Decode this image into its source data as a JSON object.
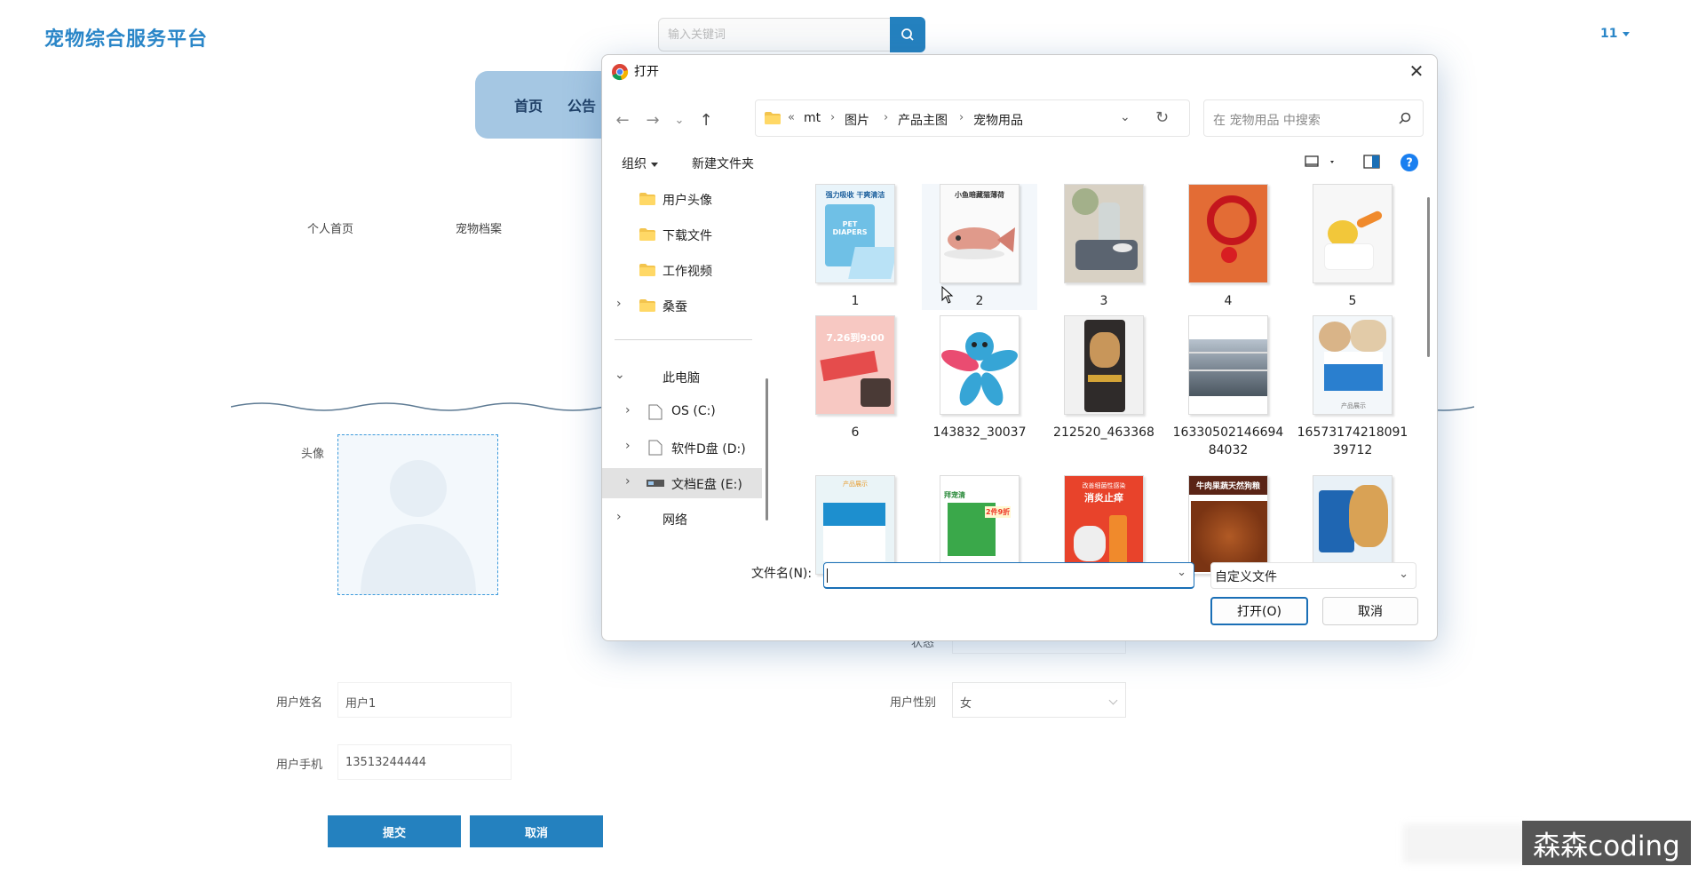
{
  "page": {
    "brand": "宠物综合服务平台",
    "search_placeholder": "输入关键词",
    "user_menu": "11",
    "nav": [
      "首页",
      "公告"
    ],
    "sub_nav": [
      "个人首页",
      "宠物档案"
    ],
    "form": {
      "avatar_label": "头像",
      "name_label": "用户姓名",
      "name_value": "用户1",
      "phone_label": "用户手机",
      "phone_value": "13513244444",
      "gender_label": "用户性别",
      "gender_value": "女",
      "submit_label": "提交",
      "cancel_label": "取消"
    },
    "watermark": "森森coding"
  },
  "dialog": {
    "title": "打开",
    "breadcrumb": [
      "«",
      "mt",
      "图片",
      "产品主图",
      "宠物用品"
    ],
    "search_placeholder": "在 宠物用品 中搜索",
    "toolbar": {
      "organize": "组织",
      "new_folder": "新建文件夹"
    },
    "sidebar": [
      {
        "label": "用户头像",
        "type": "folder",
        "expandable": false
      },
      {
        "label": "下载文件",
        "type": "folder",
        "expandable": false
      },
      {
        "label": "工作视频",
        "type": "folder",
        "expandable": false
      },
      {
        "label": "桑蚕",
        "type": "folder",
        "expandable": true
      },
      {
        "label": "此电脑",
        "type": "pc",
        "expanded": true
      },
      {
        "label": "OS (C:)",
        "type": "drive",
        "expandable": true
      },
      {
        "label": "软件D盘 (D:)",
        "type": "drive",
        "expandable": true
      },
      {
        "label": "文档E盘 (E:)",
        "type": "drive",
        "expandable": true,
        "selected": true
      },
      {
        "label": "网络",
        "type": "network",
        "expandable": true
      }
    ],
    "files": [
      {
        "name": "1",
        "thumb": "diapers"
      },
      {
        "name": "2",
        "thumb": "fish-toy"
      },
      {
        "name": "3",
        "thumb": "pet-bowl"
      },
      {
        "name": "4",
        "thumb": "red-collar"
      },
      {
        "name": "5",
        "thumb": "bee-toy"
      },
      {
        "name": "6",
        "thumb": "cat-treats"
      },
      {
        "name": "143832_30037",
        "thumb": "rubber-toy"
      },
      {
        "name": "212520_463368",
        "thumb": "dog-food-bag"
      },
      {
        "name": "1633050214669484032",
        "thumb": "pet-store"
      },
      {
        "name": "1657317421809139712",
        "thumb": "medicine-box"
      },
      {
        "name": "",
        "thumb": "blue-box"
      },
      {
        "name": "",
        "thumb": "green-box"
      },
      {
        "name": "",
        "thumb": "spray"
      },
      {
        "name": "",
        "thumb": "dog-food"
      },
      {
        "name": "",
        "thumb": "dog-bag"
      }
    ],
    "overlay_text": {
      "diapers_top": "强力吸收 干爽清洁",
      "diapers_brand": "PET DIAPERS",
      "fish_top": "小鱼暗藏猫薄荷",
      "treats_text": "7.26到9:00",
      "box_text": "产品展示",
      "green_text": "拜宠清",
      "green_promo": "2件9折",
      "spray_text": "消炎止痒",
      "spray_top": "改善细菌性感染",
      "dogfood_text": "牛肉果蔬天然狗粮"
    },
    "filename_label": "文件名(N):",
    "filename_value": "",
    "filetype": "自定义文件",
    "open_button": "打开(O)",
    "cancel_button": "取消"
  },
  "colors": {
    "brand": "#2a86c8",
    "primary_button": "#2481bf",
    "nav_bg": "#a5c7e3",
    "dialog_accent": "#1a6fb6"
  }
}
